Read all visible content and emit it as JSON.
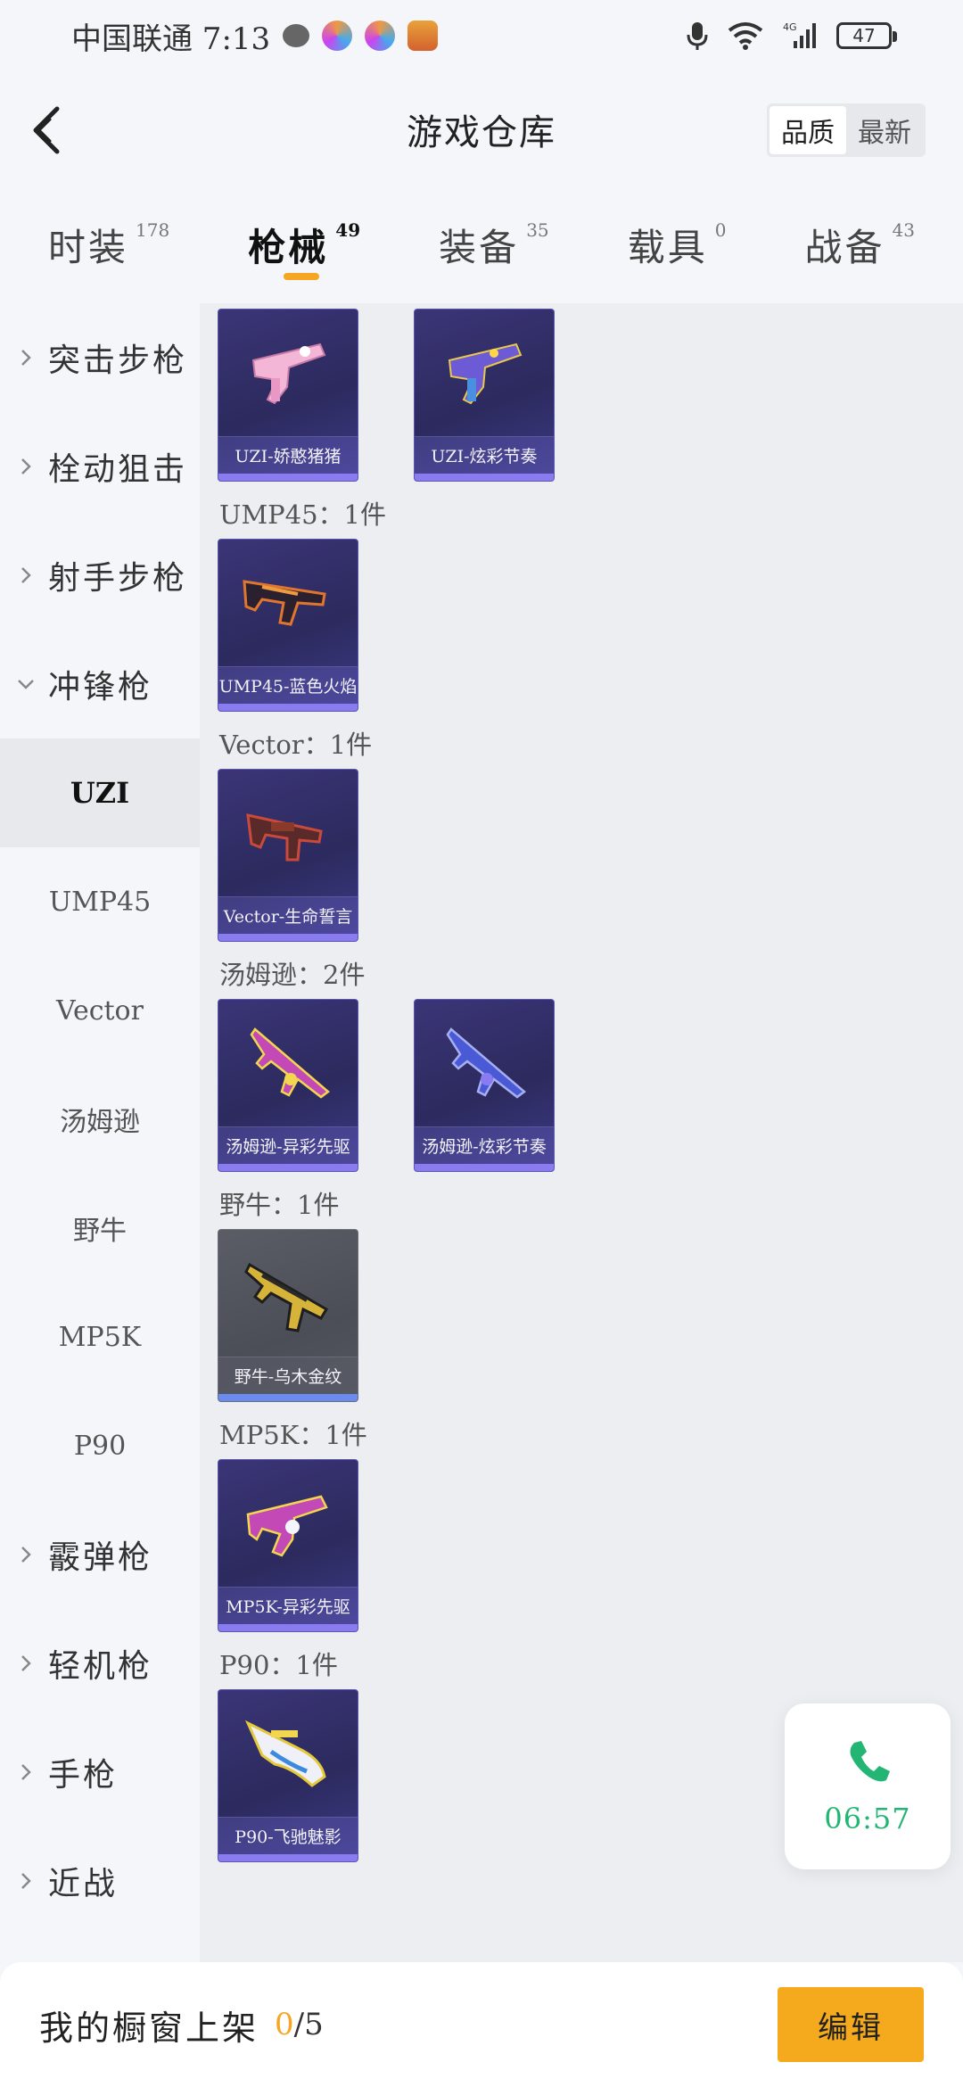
{
  "status_bar": {
    "carrier_time": "中国联通 7:13",
    "battery": "47",
    "network": "4G"
  },
  "header": {
    "title": "游戏仓库",
    "sort_options": [
      "品质",
      "最新"
    ],
    "active_sort": "品质"
  },
  "tabs": [
    {
      "label": "时装",
      "count": "178"
    },
    {
      "label": "枪械",
      "count": "49",
      "active": true
    },
    {
      "label": "装备",
      "count": "35"
    },
    {
      "label": "载具",
      "count": "0"
    },
    {
      "label": "战备",
      "count": "43"
    }
  ],
  "sidebar": {
    "groups": [
      {
        "label": "突击步枪"
      },
      {
        "label": "栓动狙击"
      },
      {
        "label": "射手步枪"
      },
      {
        "label": "冲锋枪",
        "expanded": true
      }
    ],
    "sub_items": [
      "UZI",
      "UMP45",
      "Vector",
      "汤姆逊",
      "野牛",
      "MP5K",
      "P90"
    ],
    "active_sub": "UZI",
    "groups_after": [
      {
        "label": "霰弹枪"
      },
      {
        "label": "轻机枪"
      },
      {
        "label": "手枪"
      },
      {
        "label": "近战"
      }
    ]
  },
  "content": {
    "sections": [
      {
        "title": "",
        "items": [
          "UZI-娇憨猪猪",
          "UZI-炫彩节奏"
        ]
      },
      {
        "title": "UMP45：1件",
        "items": [
          "UMP45-蓝色火焰"
        ]
      },
      {
        "title": "Vector：1件",
        "items": [
          "Vector-生命誓言"
        ]
      },
      {
        "title": "汤姆逊：2件",
        "items": [
          "汤姆逊-异彩先驱",
          "汤姆逊-炫彩节奏"
        ]
      },
      {
        "title": "野牛：1件",
        "items": [
          "野牛-乌木金纹"
        ]
      },
      {
        "title": "MP5K：1件",
        "items": [
          "MP5K-异彩先驱"
        ]
      },
      {
        "title": "P90：1件",
        "items": [
          "P90-飞驰魅影"
        ]
      }
    ]
  },
  "call_bubble": {
    "time": "06:57",
    "color": "#22b573"
  },
  "bottom_bar": {
    "label": "我的橱窗上架",
    "current": "0",
    "total": "/5",
    "edit_label": "编辑",
    "accent": "#f5a623"
  }
}
